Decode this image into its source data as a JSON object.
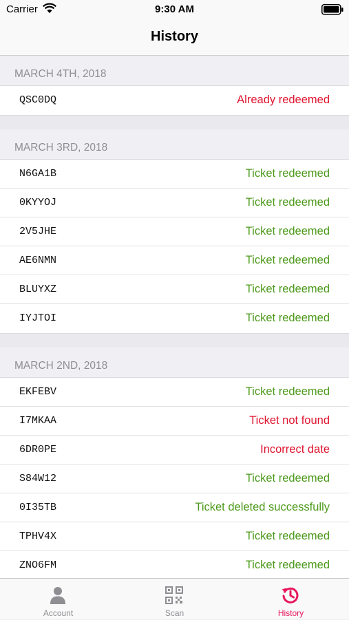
{
  "status_bar": {
    "carrier": "Carrier",
    "time": "9:30 AM"
  },
  "nav": {
    "title": "History"
  },
  "sections": [
    {
      "date": "MARCH 4TH, 2018",
      "entries": [
        {
          "code": "QSC0DQ",
          "status": "Already redeemed",
          "state": "err"
        }
      ]
    },
    {
      "date": "MARCH 3RD, 2018",
      "entries": [
        {
          "code": "N6GA1B",
          "status": "Ticket redeemed",
          "state": "ok"
        },
        {
          "code": "0KYYOJ",
          "status": "Ticket redeemed",
          "state": "ok"
        },
        {
          "code": "2V5JHE",
          "status": "Ticket redeemed",
          "state": "ok"
        },
        {
          "code": "AE6NMN",
          "status": "Ticket redeemed",
          "state": "ok"
        },
        {
          "code": "BLUYXZ",
          "status": "Ticket redeemed",
          "state": "ok"
        },
        {
          "code": "IYJTOI",
          "status": "Ticket redeemed",
          "state": "ok"
        }
      ]
    },
    {
      "date": "MARCH 2ND, 2018",
      "entries": [
        {
          "code": "EKFEBV",
          "status": "Ticket redeemed",
          "state": "ok"
        },
        {
          "code": "I7MKAA",
          "status": "Ticket not found",
          "state": "err"
        },
        {
          "code": "6DR0PE",
          "status": "Incorrect date",
          "state": "err"
        },
        {
          "code": "S84W12",
          "status": "Ticket redeemed",
          "state": "ok"
        },
        {
          "code": "0I35TB",
          "status": "Ticket deleted successfully",
          "state": "ok"
        },
        {
          "code": "TPHV4X",
          "status": "Ticket redeemed",
          "state": "ok"
        },
        {
          "code": "ZNO6FM",
          "status": "Ticket redeemed",
          "state": "ok"
        }
      ]
    }
  ],
  "tabs": [
    {
      "label": "Account",
      "icon": "person-icon",
      "active": false
    },
    {
      "label": "Scan",
      "icon": "qr-code-icon",
      "active": false
    },
    {
      "label": "History",
      "icon": "history-icon",
      "active": true
    }
  ],
  "colors": {
    "success": "#4d9a1b",
    "error": "#e0142f",
    "accent": "#e8175d",
    "inactive": "#8e8e93"
  }
}
